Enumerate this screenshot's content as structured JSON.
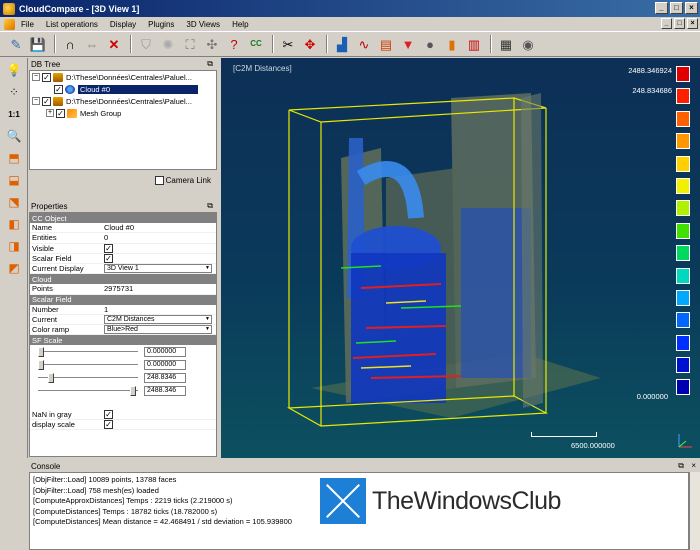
{
  "window": {
    "title": "CloudCompare - [3D View 1]"
  },
  "menu": [
    "File",
    "List operations",
    "Display",
    "Plugins",
    "3D Views",
    "Help"
  ],
  "db_tree": {
    "title": "DB Tree",
    "rows": [
      {
        "label": "D:\\These\\Données\\Centrales\\Paluel...",
        "level": 0,
        "icon": "folder"
      },
      {
        "label": "Cloud #0",
        "level": 1,
        "icon": "cloud",
        "selected": true
      },
      {
        "label": "D:\\These\\Données\\Centrales\\Paluel...",
        "level": 0,
        "icon": "folder"
      },
      {
        "label": "Mesh Group",
        "level": 1,
        "icon": "mesh"
      }
    ],
    "camera_link_label": "Camera Link"
  },
  "properties": {
    "title": "Properties",
    "sections": {
      "cc_object": "CC Object",
      "cloud": "Cloud",
      "scalar_field": "Scalar Field",
      "sf_scale": "SF Scale"
    },
    "cc_object": {
      "name_key": "Name",
      "name_val": "Cloud #0",
      "entities_key": "Entities",
      "entities_val": "0",
      "visible_key": "Visible",
      "scalar_key": "Scalar Field",
      "display_key": "Current Display",
      "display_val": "3D View 1"
    },
    "cloud": {
      "points_key": "Points",
      "points_val": "2975731"
    },
    "scalar": {
      "number_key": "Number",
      "number_val": "1",
      "current_key": "Current",
      "current_val": "C2M Distances",
      "ramp_key": "Color ramp",
      "ramp_val": "Blue>Red"
    },
    "sf_scale": {
      "values": [
        "0.000000",
        "0.000000",
        "248.8346",
        "2488.346"
      ],
      "nan_gray_key": "NaN in gray",
      "display_scale_key": "display scale"
    }
  },
  "view": {
    "label": "[C2M Distances]",
    "scale_max": "2488.346924",
    "scale_sat": "248.834686",
    "scale_min": "0.000000",
    "scalebar_label": "6500.000000",
    "scale_colors": [
      "#e00000",
      "#ff2000",
      "#ff6000",
      "#ff9800",
      "#ffd000",
      "#f0f000",
      "#b0f000",
      "#40e000",
      "#00d860",
      "#00d8c0",
      "#00a8ff",
      "#0068ff",
      "#0030ff",
      "#0010d0",
      "#0000b0"
    ]
  },
  "console": {
    "title": "Console",
    "lines": [
      "[ObjFilter::Load] 10089 points, 13788 faces",
      "[ObjFilter::Load] 758 mesh(es) loaded",
      "[ComputeApproxDistances] Temps : 2219 ticks (2.219000 s)",
      "[ComputeDistances] Temps : 18782 ticks (18.782000 s)",
      "[ComputeDistances] Mean distance = 42.468491 / std deviation = 105.939800"
    ]
  },
  "watermark": {
    "text": "TheWindowsClub"
  }
}
